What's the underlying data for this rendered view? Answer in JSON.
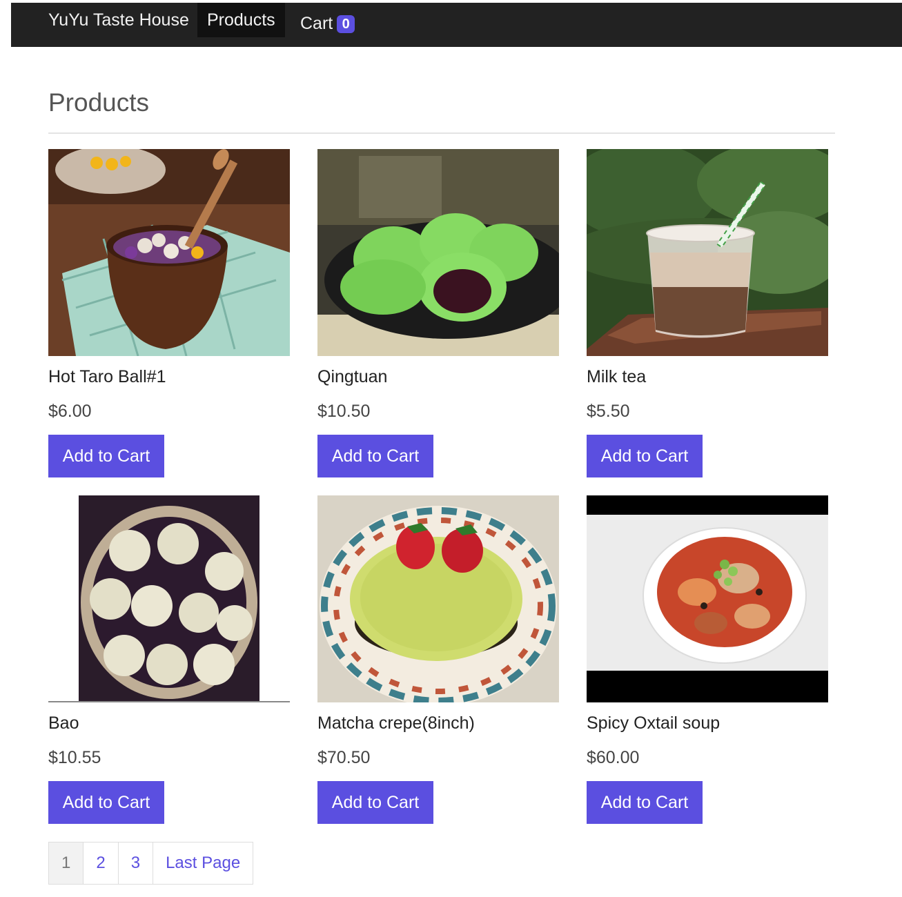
{
  "nav": {
    "brand": "YuYu Taste House",
    "products": "Products",
    "cart": "Cart",
    "cart_count": "0"
  },
  "page_title": "Products",
  "products": [
    {
      "name": "Hot Taro Ball#1",
      "price": "$6.00",
      "button": "Add to Cart"
    },
    {
      "name": "Qingtuan",
      "price": "$10.50",
      "button": "Add to Cart"
    },
    {
      "name": "Milk tea",
      "price": "$5.50",
      "button": "Add to Cart"
    },
    {
      "name": "Bao",
      "price": "$10.55",
      "button": "Add to Cart"
    },
    {
      "name": "Matcha crepe(8inch)",
      "price": "$70.50",
      "button": "Add to Cart"
    },
    {
      "name": "Spicy Oxtail soup",
      "price": "$60.00",
      "button": "Add to Cart"
    }
  ],
  "pagination": [
    "1",
    "2",
    "3",
    "Last Page"
  ],
  "colors": {
    "accent": "#5b4fe0",
    "navbar": "#222222"
  }
}
